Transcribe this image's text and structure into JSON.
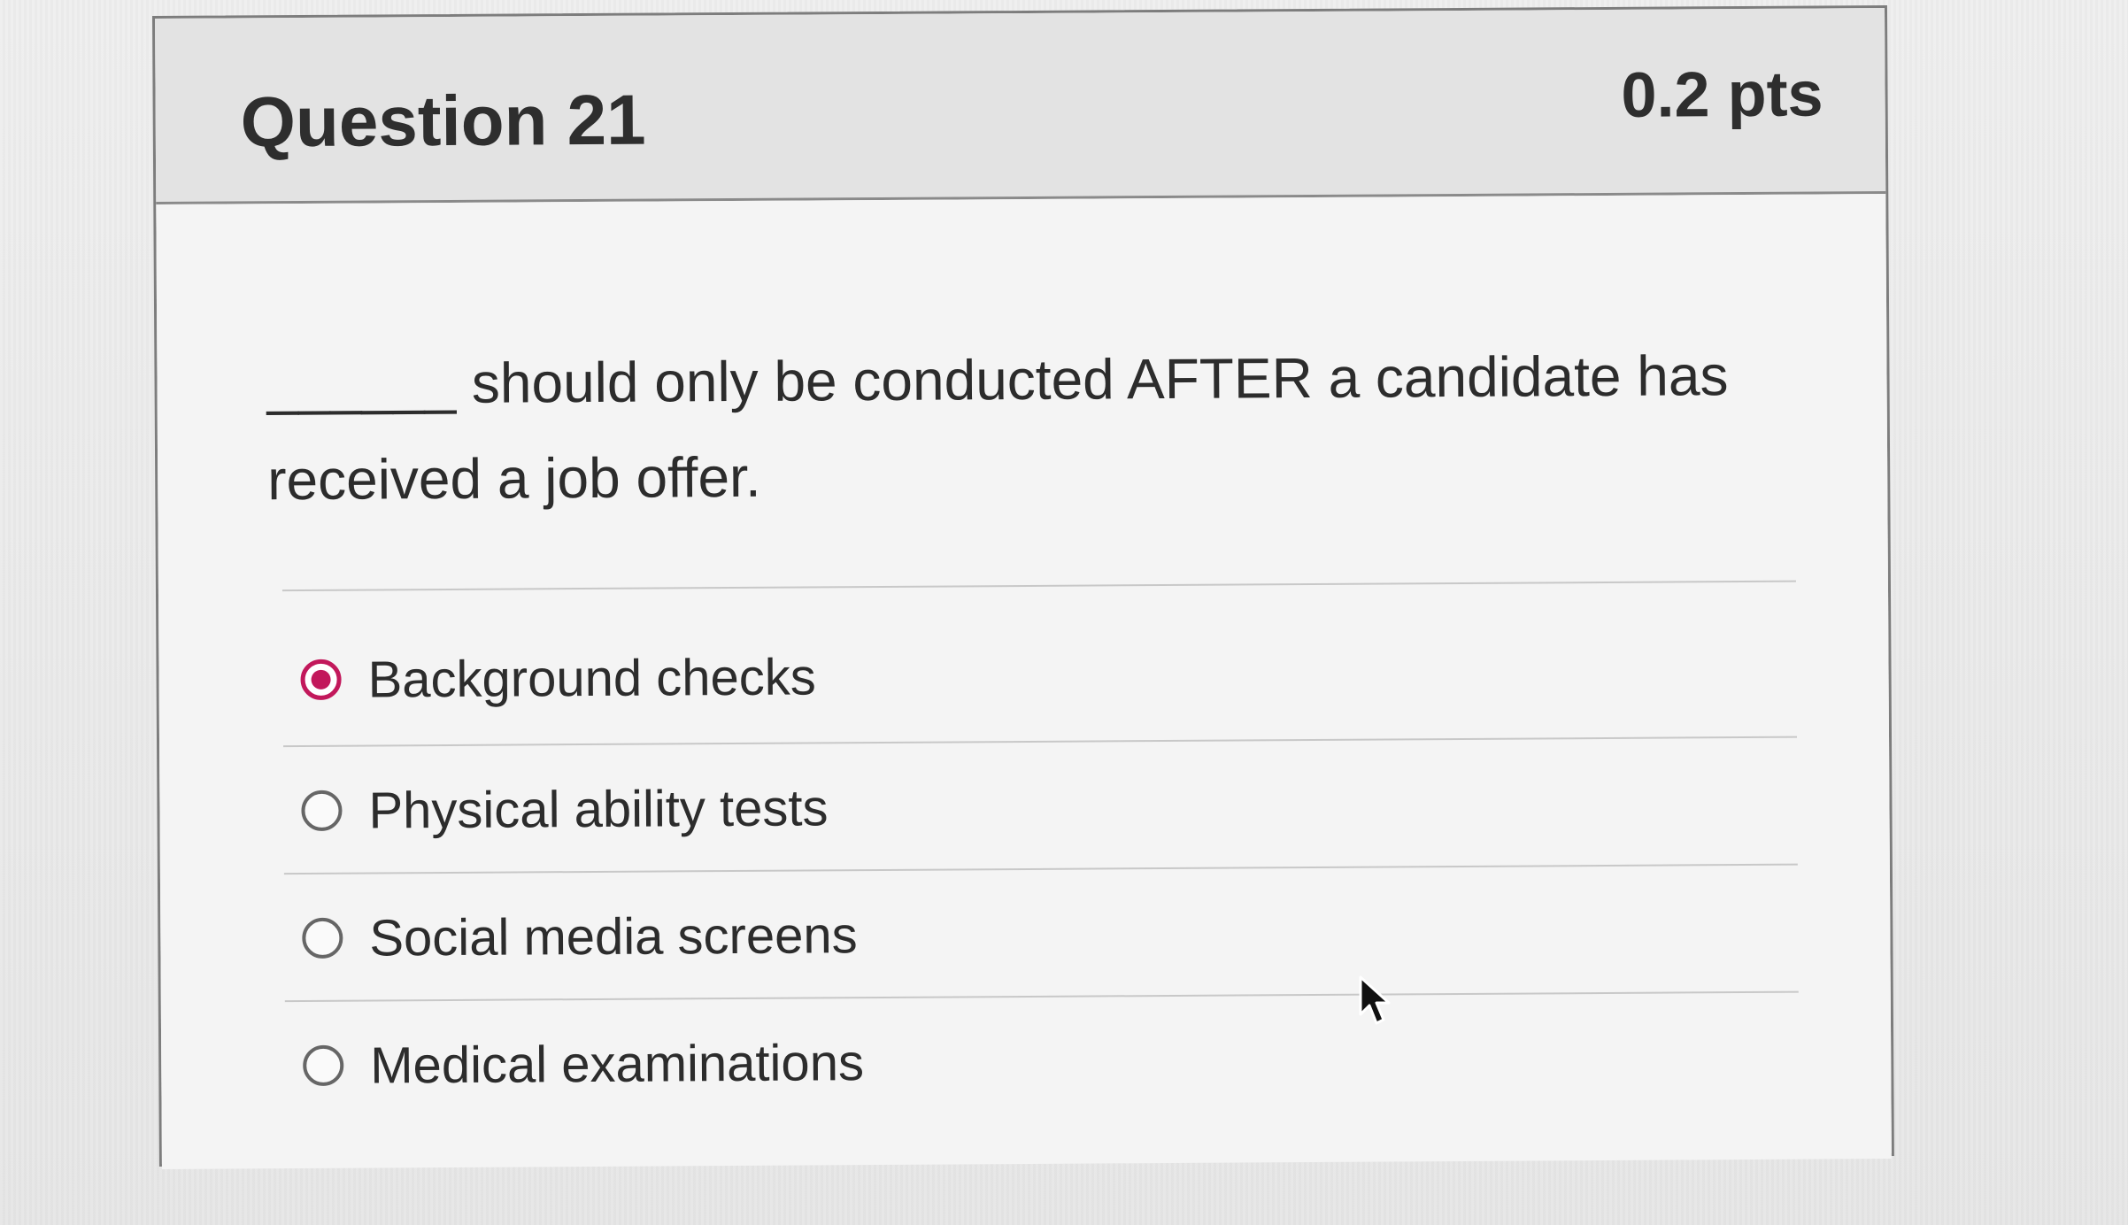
{
  "question": {
    "title": "Question 21",
    "points": "0.2 pts",
    "text": "______ should only be conducted AFTER a candidate has received a job offer."
  },
  "answers": [
    {
      "label": "Background checks",
      "selected": true
    },
    {
      "label": "Physical ability tests",
      "selected": false
    },
    {
      "label": "Social media screens",
      "selected": false
    },
    {
      "label": "Medical examinations",
      "selected": false
    }
  ],
  "colors": {
    "selected_radio": "#c2185b"
  },
  "icons": {
    "pointer": "mouse-pointer-icon"
  }
}
